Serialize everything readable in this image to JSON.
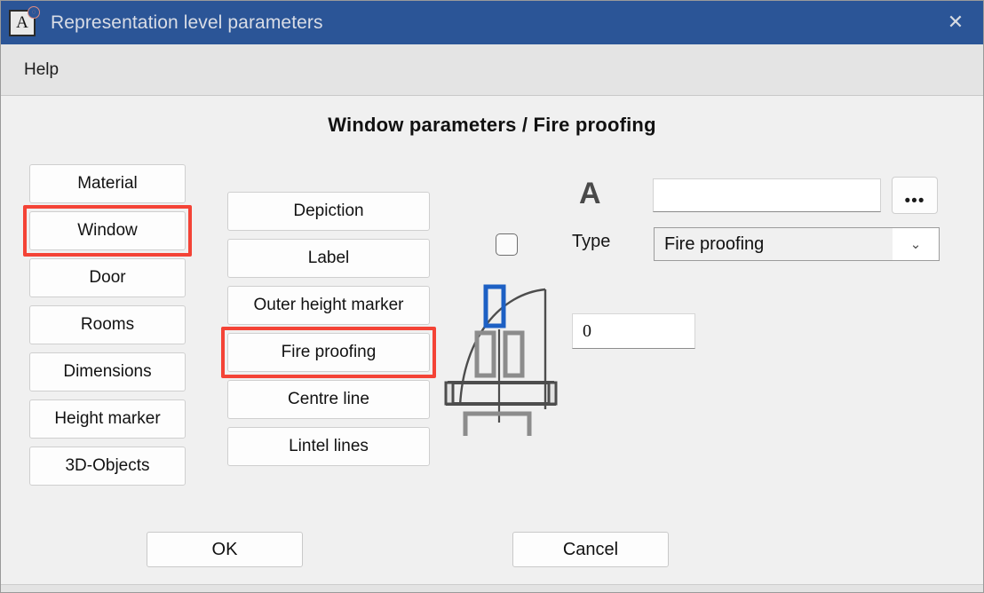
{
  "window": {
    "title": "Representation level parameters",
    "app_icon_letter": "A",
    "app_icon_badge": "◌",
    "close_icon": "✕",
    "accent_color": "#2b5597",
    "highlight_color": "#f44336"
  },
  "menubar": {
    "items": [
      {
        "label": "Help"
      }
    ]
  },
  "page": {
    "title": "Window parameters / Fire proofing"
  },
  "left_column": {
    "items": [
      {
        "label": "Material",
        "selected": false
      },
      {
        "label": "Window",
        "selected": true
      },
      {
        "label": "Door",
        "selected": false
      },
      {
        "label": "Rooms",
        "selected": false
      },
      {
        "label": "Dimensions",
        "selected": false
      },
      {
        "label": "Height marker",
        "selected": false
      },
      {
        "label": "3D-Objects",
        "selected": false
      }
    ]
  },
  "middle_column": {
    "items": [
      {
        "label": "Depiction",
        "selected": false
      },
      {
        "label": "Label",
        "selected": false
      },
      {
        "label": "Outer height marker",
        "selected": false
      },
      {
        "label": "Fire proofing",
        "selected": true
      },
      {
        "label": "Centre line",
        "selected": false
      },
      {
        "label": "Lintel lines",
        "selected": false
      }
    ]
  },
  "preview": {
    "name": "window-elevation-preview",
    "highlight_color": "#1d60c4"
  },
  "right_panel": {
    "checkbox_checked": false,
    "text_glyph": "A",
    "text_field_value": "",
    "text_field_placeholder": "",
    "browse_button_label": "•••",
    "type_label": "Type",
    "type_value": "Fire proofing",
    "type_options": [
      "Fire proofing"
    ],
    "dropdown_icon": "⌄",
    "number_value": "0"
  },
  "footer": {
    "ok_label": "OK",
    "cancel_label": "Cancel"
  }
}
